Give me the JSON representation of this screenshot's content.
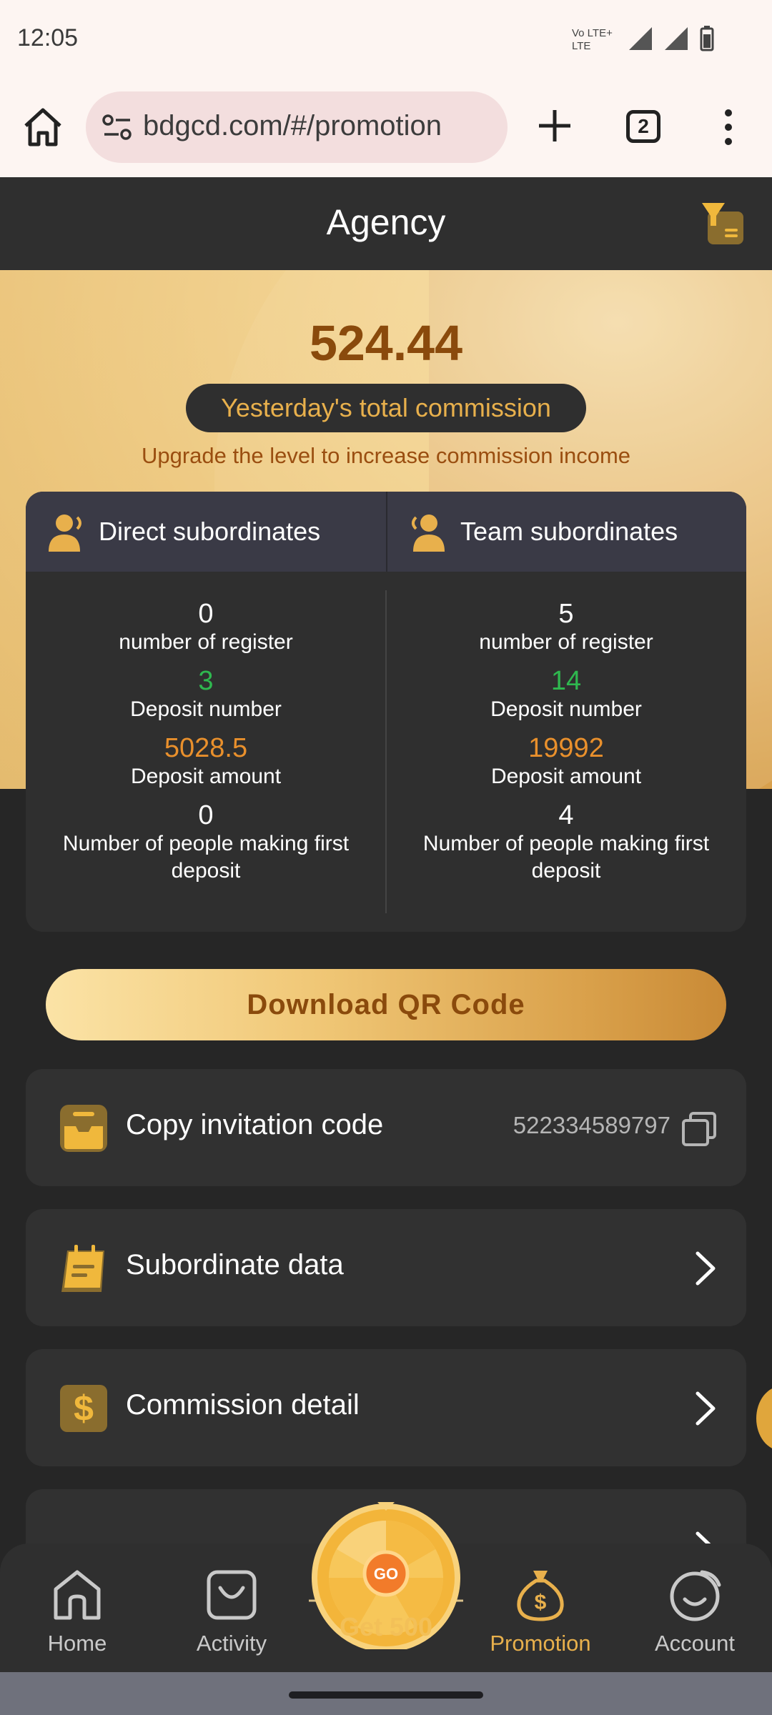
{
  "status_bar": {
    "time": "12:05"
  },
  "browser": {
    "url": "bdgcd.com/#/promotion",
    "tab_count": "2"
  },
  "header": {
    "title": "Agency"
  },
  "banner": {
    "commission_value": "524.44",
    "commission_label": "Yesterday's total commission",
    "upgrade_text": "Upgrade the level to increase commission income"
  },
  "stats": {
    "direct": {
      "title": "Direct subordinates",
      "register_count": "0",
      "register_label": "number of register",
      "deposit_number": "3",
      "deposit_number_label": "Deposit number",
      "deposit_amount": "5028.5",
      "deposit_amount_label": "Deposit amount",
      "first_deposit": "0",
      "first_deposit_label": "Number of people making first deposit"
    },
    "team": {
      "title": "Team subordinates",
      "register_count": "5",
      "register_label": "number of register",
      "deposit_number": "14",
      "deposit_number_label": "Deposit number",
      "deposit_amount": "19992",
      "deposit_amount_label": "Deposit amount",
      "first_deposit": "4",
      "first_deposit_label": "Number of people making first deposit"
    }
  },
  "download_button": "Download QR Code",
  "menu": {
    "invite_code_label": "Copy invitation code",
    "invite_code_value": "522334589797",
    "subordinate_label": "Subordinate data",
    "commission_label": "Commission detail"
  },
  "nav": {
    "home": "Home",
    "activity": "Activity",
    "wheel": "Get 500",
    "wheel_go": "GO",
    "promotion": "Promotion",
    "account": "Account"
  },
  "colors": {
    "accent_gold": "#e8b04c",
    "commission_brown": "#8a4a0c",
    "green": "#2fb84f",
    "orange": "#e9902c",
    "background": "#262626"
  }
}
